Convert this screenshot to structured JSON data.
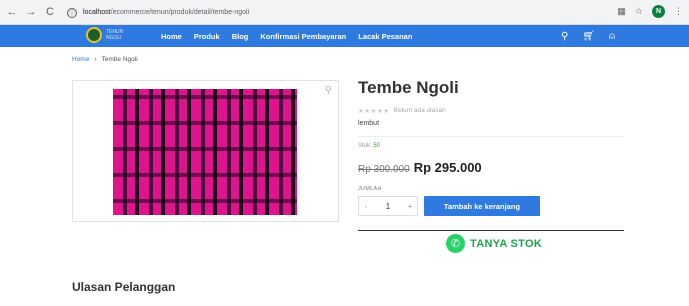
{
  "browser": {
    "back_icon": "←",
    "forward_icon": "→",
    "reload_icon": "C",
    "info_icon": "ⓘ",
    "url_host": "localhost",
    "url_path": "/ecommerce/tenun/produk/detail/tembe-ngoli",
    "profile_initial": "N"
  },
  "site": {
    "logo_text": "TENUN NGOLI",
    "menu": [
      "Home",
      "Produk",
      "Blog",
      "Konfirmasi Pembayaran",
      "Lacak Pesanan"
    ],
    "accent": "#2e7ae0"
  },
  "breadcrumb": {
    "home": "Home",
    "separator": "›",
    "current": "Tembe Ngoli"
  },
  "product": {
    "title": "Tembe Ngoli",
    "stars": "★★★★★",
    "rating_text": "Belum ada ulasan",
    "short_desc": "lembut",
    "stock_label": "Stok:",
    "stock_value": "50",
    "old_price": "Rp 300.000",
    "new_price": "Rp 295.000",
    "qty_label": "JUMLAH",
    "qty_minus": "-",
    "qty_value": "1",
    "qty_plus": "+",
    "cart_button": "Tambah ke keranjang",
    "whatsapp_label": "TANYA STOK",
    "whatsapp_color": "#25d366"
  },
  "reviews": {
    "title": "Ulasan Pelanggan"
  }
}
